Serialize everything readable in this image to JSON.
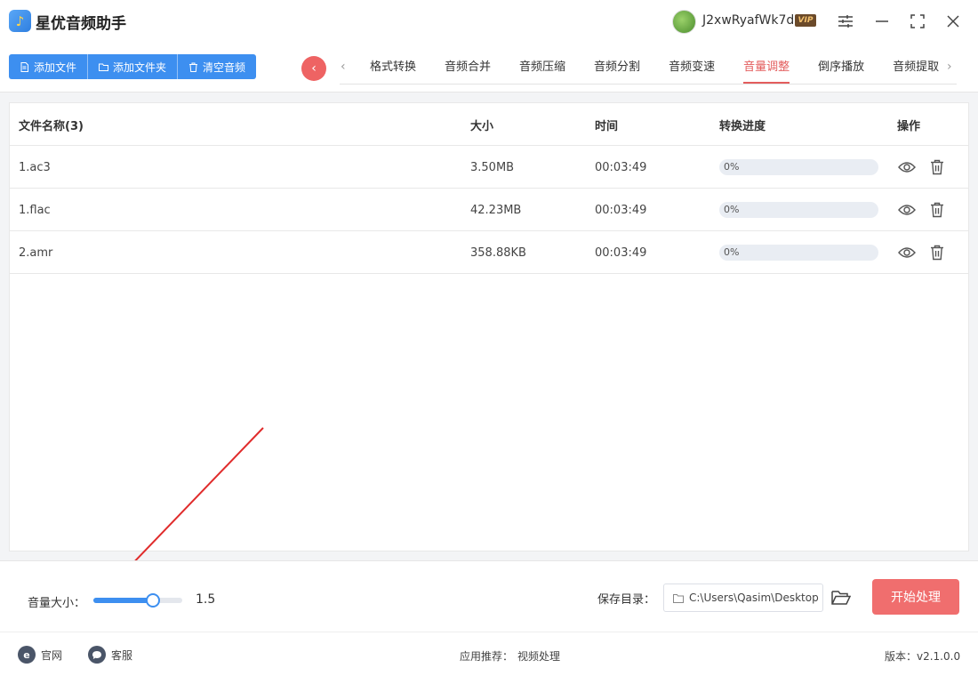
{
  "app": {
    "title": "星优音频助手"
  },
  "user": {
    "name": "J2xwRyafWk7d",
    "vip": "VIP"
  },
  "toolbar": {
    "add_file": "添加文件",
    "add_folder": "添加文件夹",
    "clear_audio": "清空音频"
  },
  "tabs": [
    {
      "label": "格式转换"
    },
    {
      "label": "音频合并"
    },
    {
      "label": "音频压缩"
    },
    {
      "label": "音频分割"
    },
    {
      "label": "音频变速"
    },
    {
      "label": "音量调整",
      "active": true
    },
    {
      "label": "倒序播放"
    },
    {
      "label": "音频提取"
    }
  ],
  "table": {
    "headers": {
      "name": "文件名称(3)",
      "size": "大小",
      "time": "时间",
      "progress": "转换进度",
      "ops": "操作"
    },
    "rows": [
      {
        "name": "1.ac3",
        "size": "3.50MB",
        "time": "00:03:49",
        "progress": "0%",
        "progress_value": 0
      },
      {
        "name": "1.flac",
        "size": "42.23MB",
        "time": "00:03:49",
        "progress": "0%",
        "progress_value": 0
      },
      {
        "name": "2.amr",
        "size": "358.88KB",
        "time": "00:03:49",
        "progress": "0%",
        "progress_value": 0
      }
    ]
  },
  "settings": {
    "volume_label": "音量大小：",
    "volume_value": "1.5",
    "volume_fraction": 0.67,
    "save_label": "保存目录：",
    "save_path": "C:\\Users\\Qasim\\Desktop",
    "start_button": "开始处理"
  },
  "footer": {
    "website": "官网",
    "support": "客服",
    "recommend_label": "应用推荐：",
    "recommend_item": "视频处理",
    "version": "版本：v2.1.0.0"
  },
  "colors": {
    "primary": "#3d8ff0",
    "accent": "#e35d5d",
    "start": "#f06e6e",
    "annotation": "#e02b2b"
  }
}
